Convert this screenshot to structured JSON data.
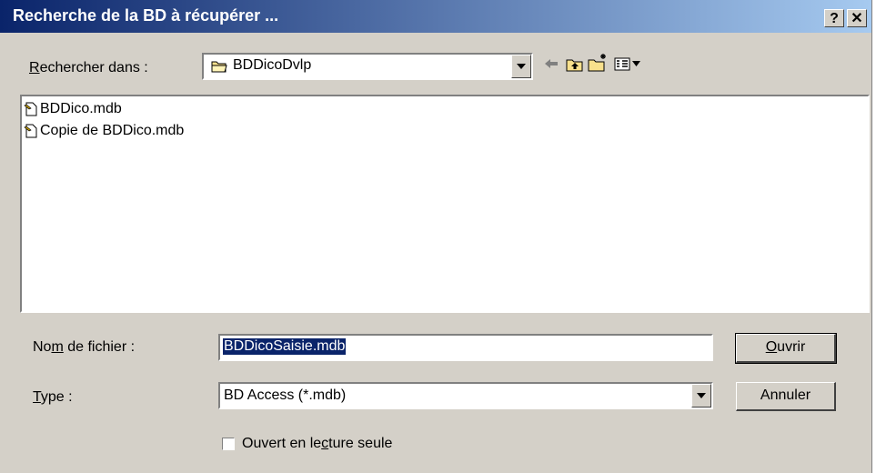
{
  "window": {
    "title": "Recherche de la BD à récupérer ...",
    "help_label": "?",
    "close_label": "✕"
  },
  "lookin": {
    "label_prefix": "R",
    "label_rest": "echercher dans :",
    "value": "BDDicoDvlp"
  },
  "toolbar": {
    "icons": [
      "back-icon",
      "up-folder-icon",
      "new-folder-icon",
      "view-menu-icon"
    ]
  },
  "files": [
    {
      "name": "BDDico.mdb",
      "icon": "access-db-icon"
    },
    {
      "name": "Copie de BDDico.mdb",
      "icon": "access-db-icon"
    }
  ],
  "filename": {
    "label_a": "No",
    "label_u": "m",
    "label_b": " de fichier :",
    "value": "BDDicoSaisie.mdb"
  },
  "filetype": {
    "label_u": "T",
    "label_rest": "ype :",
    "value": "BD Access (*.mdb)"
  },
  "readonly": {
    "label_a": "Ouvert en le",
    "label_u": "c",
    "label_b": "ture seule",
    "checked": false
  },
  "buttons": {
    "open_u": "O",
    "open_rest": "uvrir",
    "cancel": "Annuler"
  },
  "colors": {
    "title_start": "#0a246a",
    "title_end": "#a6caf0",
    "face": "#d4d0c8",
    "selection": "#0a246a"
  }
}
